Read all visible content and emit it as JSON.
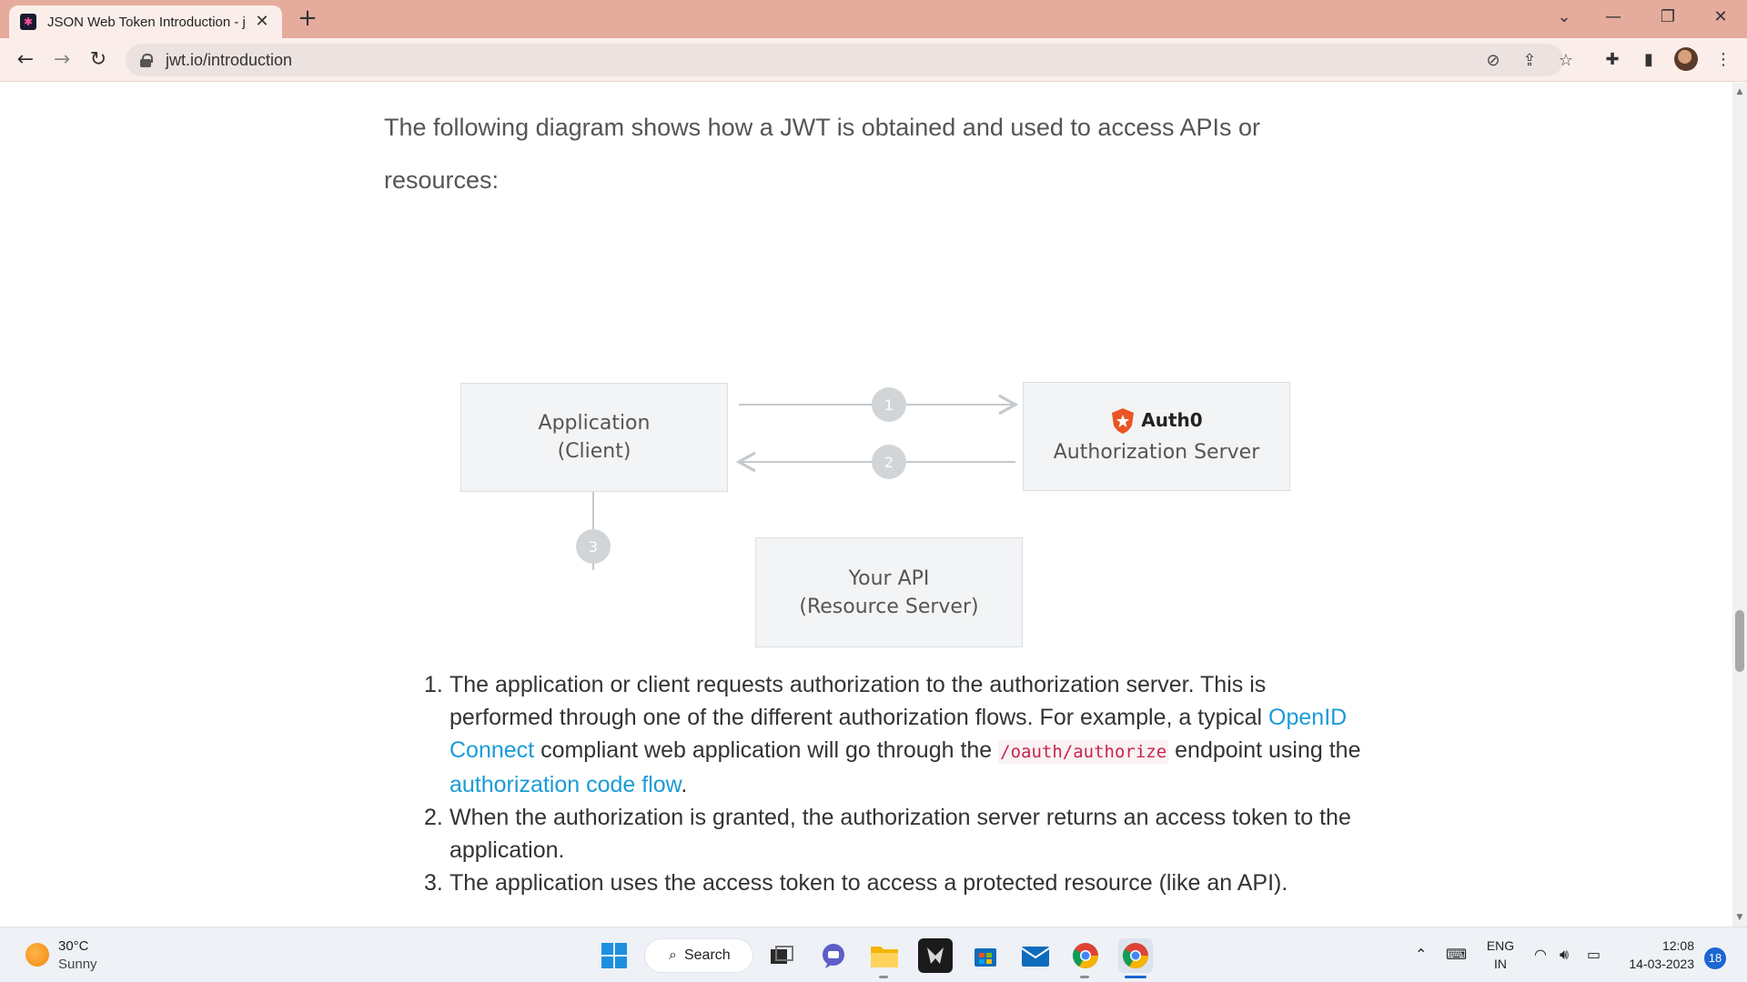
{
  "browser": {
    "tab_title": "JSON Web Token Introduction - j",
    "url": "jwt.io/introduction"
  },
  "page": {
    "intro_text": "The following diagram shows how a JWT is obtained and used to access APIs or resources:",
    "diagram": {
      "client_line1": "Application",
      "client_line2": "(Client)",
      "auth_brand": "Auth0",
      "auth_label": "Authorization Server",
      "api_line1": "Your API",
      "api_line2": "(Resource Server)",
      "step1": "1",
      "step2": "2",
      "step3": "3"
    },
    "steps": [
      {
        "num": "1.",
        "text_a": "The application or client requests authorization to the authorization server. This is performed through one of the different authorization flows. For example, a typical ",
        "link_a": "OpenID Connect",
        "text_b": " compliant web application will go through the ",
        "code": "/oauth/authorize",
        "text_c": " endpoint using the ",
        "link_b": "authorization code flow",
        "text_d": "."
      },
      {
        "num": "2.",
        "text": "When the authorization is granted, the authorization server returns an access token to the application."
      },
      {
        "num": "3.",
        "text": "The application uses the access token to access a protected resource (like an API)."
      }
    ]
  },
  "taskbar": {
    "weather_temp": "30°C",
    "weather_desc": "Sunny",
    "search_label": "Search",
    "lang_line1": "ENG",
    "lang_line2": "IN",
    "time": "12:08",
    "date": "14-03-2023",
    "notifications": "18"
  },
  "colors": {
    "tab_strip": "#e5ab9d",
    "link": "#1a9bd7",
    "code_text": "#c7254e",
    "auth0_brand": "#eb5424"
  }
}
